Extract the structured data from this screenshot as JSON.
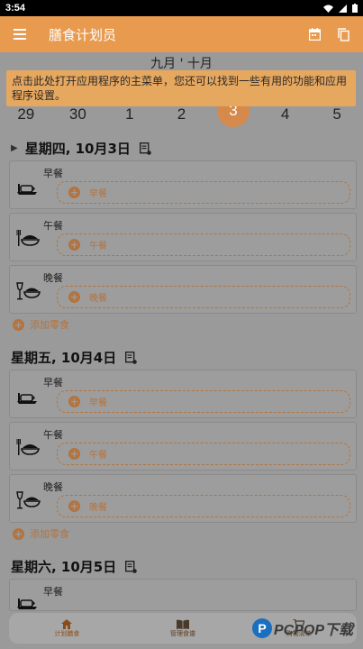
{
  "status": {
    "time": "3:54"
  },
  "appbar": {
    "title": "膳食计划员",
    "menu_icon": "menu-icon",
    "calendar_icon": "calendar-icon",
    "copy_icon": "copy-icon",
    "color": "#e89a4f"
  },
  "tooltip": {
    "text": "点击此处打开应用程序的主菜单，您还可以找到一些有用的功能和应用程序设置。"
  },
  "calendar": {
    "months": "九月 ' 十月",
    "dates": [
      "29",
      "30",
      "1",
      "2",
      "3",
      "4",
      "5"
    ],
    "selected": "3"
  },
  "days": [
    {
      "title": "星期四, 10月3日",
      "meals": [
        {
          "label": "早餐",
          "slot": "早餐"
        },
        {
          "label": "午餐",
          "slot": "午餐"
        },
        {
          "label": "晚餐",
          "slot": "晚餐"
        }
      ],
      "add_snack": "添加零食"
    },
    {
      "title": "星期五, 10月4日",
      "meals": [
        {
          "label": "早餐",
          "slot": "早餐"
        },
        {
          "label": "午餐",
          "slot": "午餐"
        },
        {
          "label": "晚餐",
          "slot": "晚餐"
        }
      ],
      "add_snack": "添加零食"
    },
    {
      "title": "星期六, 10月5日",
      "meals": [
        {
          "label": "早餐",
          "slot": ""
        }
      ]
    }
  ],
  "bottomnav": {
    "items": [
      {
        "label": "计划膳食",
        "icon": "home-icon"
      },
      {
        "label": "管理食谱",
        "icon": "book-icon"
      },
      {
        "label": "购物清单",
        "icon": "cart-icon"
      }
    ]
  },
  "watermark": {
    "text": "PCPOP下载"
  }
}
